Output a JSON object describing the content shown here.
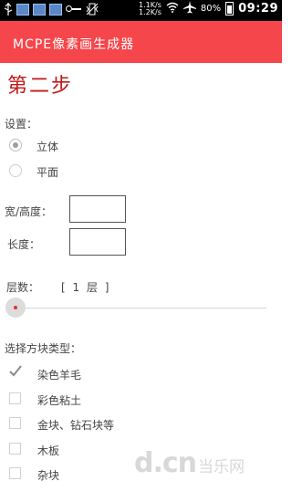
{
  "status_bar": {
    "net_up": "1.1K/s",
    "net_down": "1.2K/s",
    "battery_pct": "80%",
    "time": "09:29"
  },
  "app": {
    "title": "MCPE像素画生成器"
  },
  "step_title": "第二步",
  "settings": {
    "label": "设置：",
    "options": [
      {
        "label": "立体",
        "selected": true
      },
      {
        "label": "平面",
        "selected": false
      }
    ]
  },
  "size": {
    "width_height_label": "宽/高度：",
    "width_height_value": "",
    "length_label": "长度：",
    "length_value": ""
  },
  "layers": {
    "label": "层数：",
    "value_text": "[ 1 层 ]",
    "slider_value": 1
  },
  "block_types": {
    "label": "选择方块类型：",
    "items": [
      {
        "label": "染色羊毛",
        "checked": true
      },
      {
        "label": "彩色粘土",
        "checked": false
      },
      {
        "label": "金块、钻石块等",
        "checked": false
      },
      {
        "label": "木板",
        "checked": false
      },
      {
        "label": "杂块",
        "checked": false
      }
    ]
  },
  "watermark": {
    "logo": "d.cn",
    "text": "当乐网"
  }
}
